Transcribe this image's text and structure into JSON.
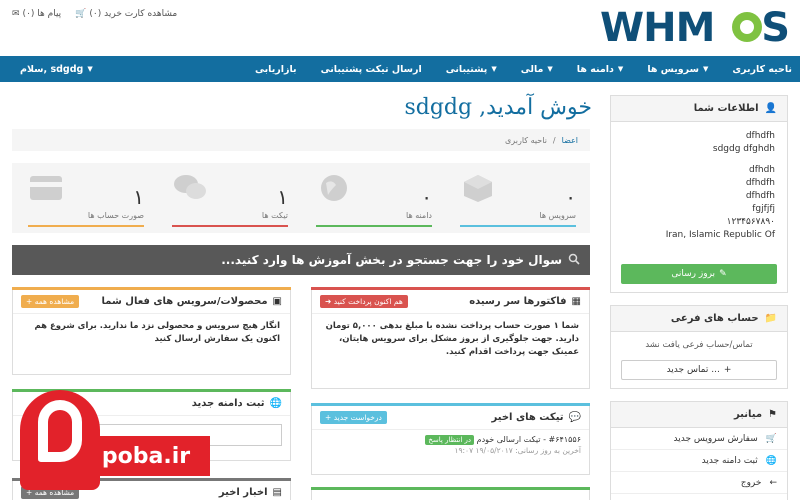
{
  "topbar": {
    "cart_label": "مشاهده کارت خرید (۰)",
    "messages_label": "پیام ها (۰)",
    "logo_text_main": "WHM",
    "logo_text_tail": "S"
  },
  "nav": {
    "items": [
      {
        "label": "ناحیه کاربری",
        "caret": false
      },
      {
        "label": "سرویس ها",
        "caret": true
      },
      {
        "label": "دامنه ها",
        "caret": true
      },
      {
        "label": "مالی",
        "caret": true
      },
      {
        "label": "پشتیبانی",
        "caret": true
      },
      {
        "label": "ارسال تیکت پشتیبانی",
        "caret": false
      },
      {
        "label": "بازاریابی",
        "caret": false
      }
    ],
    "account_label": "سلام, sdgdg",
    "caret_glyph": "▼"
  },
  "welcome_title": "خوش آمدید, sdgdg",
  "breadcrumb": {
    "home": "اعضا",
    "sep": "/",
    "current": "ناحیه کاربری"
  },
  "tiles": [
    {
      "value": "۰",
      "label": "سرویس ها",
      "color": "#5bc0de"
    },
    {
      "value": "۰",
      "label": "دامنه ها",
      "color": "#5cb85c"
    },
    {
      "value": "۱",
      "label": "تیکت ها",
      "color": "#d9534f"
    },
    {
      "value": "۱",
      "label": "صورت حساب ها",
      "color": "#f0ad4e"
    }
  ],
  "search_placeholder": "سوال خود را جهت جستجو در بخش آموزش ها وارد کنید...",
  "sidebar": {
    "info_title": "اطلاعات شما",
    "info_lines_top": [
      "dfhdfh",
      "sdgdg dfghdh"
    ],
    "info_lines_bottom": [
      "dfhdh",
      "dfhdfh",
      "dfhdfh",
      "fgjfjfj",
      "۱۲۳۴۵۶۷۸۹۰",
      "Iran, Islamic Republic Of"
    ],
    "update_button": "بروز رسانی",
    "subaccounts_title": "حساب های فرعی",
    "subaccounts_empty": "تماس/حساب فرعی یافت نشد",
    "new_contact_button": "تماس جدید ...",
    "shortcuts_title": "میانبر",
    "shortcuts": [
      "سفارش سرویس جدید",
      "ثبت دامنه جدید",
      "خروج"
    ]
  },
  "cards": {
    "invoices": {
      "title": "فاکتورها سر رسیده",
      "tag": "هم اکنون پرداخت کنید",
      "body": "شما ۱ صورت حساب پرداخت نشده با مبلغ بدهی ۵,۰۰۰ تومان دارید. جهت جلوگیری از بروز مشکل برای سرویس هایتان، عمینک جهت پرداخت اقدام کنید.",
      "accent": "#d9534f"
    },
    "services": {
      "title": "محصولات/سرویس های فعال شما",
      "tag": "مشاهده همه",
      "body": "انگار هیچ سرویس و محصولی نزد ما ندارید. برای شروع هم اکنون یک سفارش ارسال کنید",
      "accent": "#f0ad4e"
    },
    "tickets": {
      "title": "تیکت های اخیر",
      "tag": "درخواست جدید",
      "ticket_line": "#۶۴۱۵۵۶ - تیکت ارسالی خودم",
      "ticket_badge": "در انتظار پاسخ",
      "ticket_sub": "آخرین به روز رسانی: ۱۹/۰۵/۲۰۱۷ ۱۹:۰۷",
      "accent": "#5bc0de"
    },
    "domain": {
      "title": "ثبت دامنه جدید",
      "accent": "#5cb85c"
    },
    "news": {
      "title": "اخبار اخیر",
      "tag": "مشاهده همه",
      "accent": "#777777"
    }
  },
  "watermark": {
    "text": "poba.ir"
  }
}
